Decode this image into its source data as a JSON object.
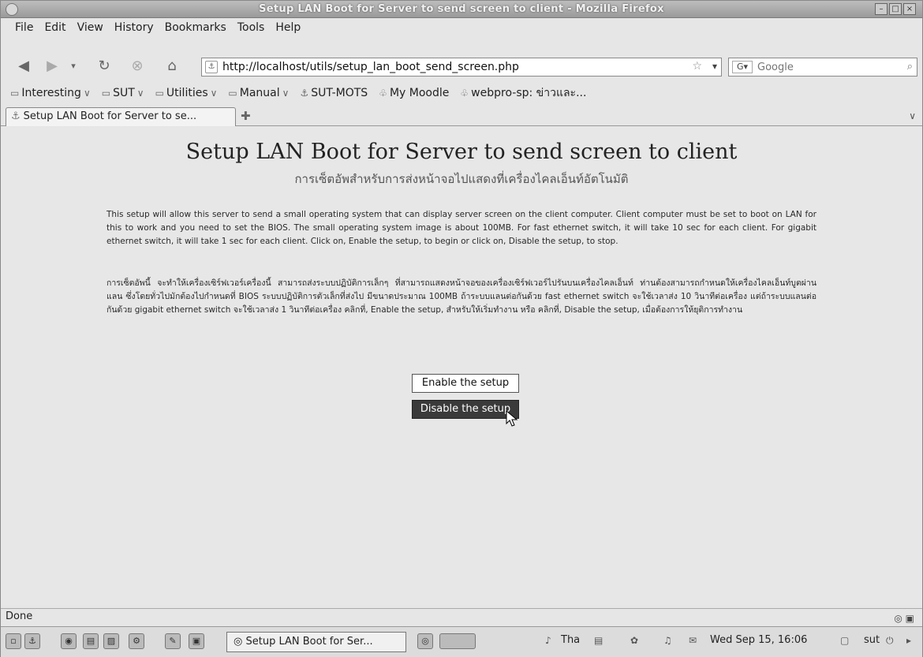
{
  "window": {
    "title": "Setup LAN Boot for Server to send screen to client - Mozilla Firefox"
  },
  "menu": [
    "File",
    "Edit",
    "View",
    "History",
    "Bookmarks",
    "Tools",
    "Help"
  ],
  "nav": {
    "url": "http://localhost/utils/setup_lan_boot_send_screen.php",
    "search_placeholder": "Google"
  },
  "bookmarks": [
    "Interesting",
    "SUT",
    "Utilities",
    "Manual",
    "SUT-MOTS",
    "My Moodle",
    "webpro-sp: ข่าวและ..."
  ],
  "tab": {
    "label": "Setup LAN Boot for Server to se..."
  },
  "page": {
    "title": "Setup LAN Boot for Server to send screen to client",
    "subtitle": "การเซ็ตอัพสำหรับการส่งหน้าจอไปแสดงที่เครื่องไคลเอ็นท์อัตโนมัติ",
    "desc_en": "This setup will allow this server to send a small operating system that can display server screen on the client computer. Client computer must be set to boot on LAN for this to work and you need to set the BIOS. The small operating system image is about 100MB. For fast ethernet switch, it will take 10 sec for each client. For gigabit ethernet switch, it will take 1 sec for each client. Click on, Enable the setup, to begin or click on, Disable the setup, to stop.",
    "desc_th": "การเซ็ตอัพนี้ จะทำให้เครื่องเซิร์ฟเวอร์เครื่องนี้ สามารถส่งระบบปฏิบัติการเล็กๆ ที่สามารถแสดงหน้าจอของเครื่องเซิร์ฟเวอร์ไปรันบนเครื่องไคลเอ็นท์ ท่านต้องสามารถกำหนดให้เครื่องไคลเอ็นท์บูตผ่านแลน ซึ่งโดยทั่วไปมักต้องไปกำหนดที่ BIOS ระบบปฏิบัติการตัวเล็กที่ส่งไป มีขนาดประมาณ 100MB ถ้าระบบแลนต่อกันด้วย fast ethernet switch จะใช้เวลาส่ง 10 วินาทีต่อเครื่อง แต่ถ้าระบบแลนต่อกันด้วย gigabit ethernet switch จะใช้เวลาส่ง 1 วินาทีต่อเครื่อง คลิกที่, Enable the setup, สำหรับให้เริ่มทำงาน หรือ คลิกที่, Disable the setup, เมื่อต้องการให้ยุติการทำงาน",
    "enable_label": "Enable the setup",
    "disable_label": "Disable the setup"
  },
  "status": {
    "text": "Done"
  },
  "taskbar": {
    "task_label": "Setup LAN Boot for Ser...",
    "lang": "Tha",
    "clock": "Wed Sep 15, 16:06",
    "user": "sut"
  }
}
